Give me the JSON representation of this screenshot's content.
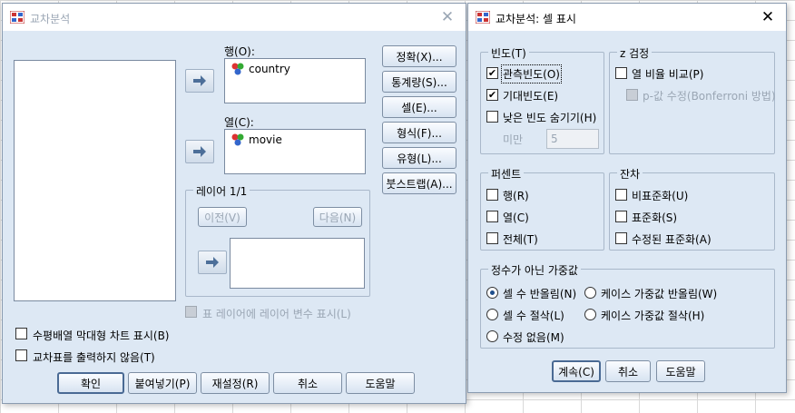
{
  "main_dialog": {
    "title": "교차분석",
    "row_label": "행(O):",
    "row_var": "country",
    "col_label": "열(C):",
    "col_var": "movie",
    "layer_group": "레이어 1/1",
    "prev_btn": "이전(V)",
    "next_btn": "다음(N)",
    "layer_display_cb": "표 레이어에 레이어 변수 표시(L)",
    "side_buttons": [
      "정확(X)...",
      "통계량(S)...",
      "셀(E)...",
      "형식(F)...",
      "유형(L)...",
      "붓스트랩(A)..."
    ],
    "clustered_bar_cb": "수평배열 막대형 차트 표시(B)",
    "suppress_tables_cb": "교차표를 출력하지 않음(T)",
    "bottom_buttons": [
      "확인",
      "붙여넣기(P)",
      "재설정(R)",
      "취소",
      "도움말"
    ]
  },
  "cell_dialog": {
    "title": "교차분석: 셀 표시",
    "counts_group": "빈도(T)",
    "observed": "관측빈도(O)",
    "observed_checked": true,
    "expected": "기대빈도(E)",
    "expected_checked": true,
    "hide_small": "낮은 빈도 숨기기(H)",
    "hide_small_checked": false,
    "less_than": "미만",
    "less_than_value": "5",
    "ztest_group": "z 검정",
    "compare_cols": "열 비율 비교(P)",
    "adjust_p": "p-값 수정(Bonferroni 방법)",
    "percent_group": "퍼센트",
    "percent_items": [
      "행(R)",
      "열(C)",
      "전체(T)"
    ],
    "residual_group": "잔차",
    "residual_items": [
      "비표준화(U)",
      "표준화(S)",
      "수정된 표준화(A)"
    ],
    "noninteger_group": "정수가 아닌 가중값",
    "round_cell": "셀 수 반올림(N)",
    "round_case": "케이스 가중값 반올림(W)",
    "trunc_cell": "셀 수 절삭(L)",
    "trunc_case": "케이스 가중값 절삭(H)",
    "no_adjust": "수정 없음(M)",
    "bottom_buttons": [
      "계속(C)",
      "취소",
      "도움말"
    ]
  }
}
